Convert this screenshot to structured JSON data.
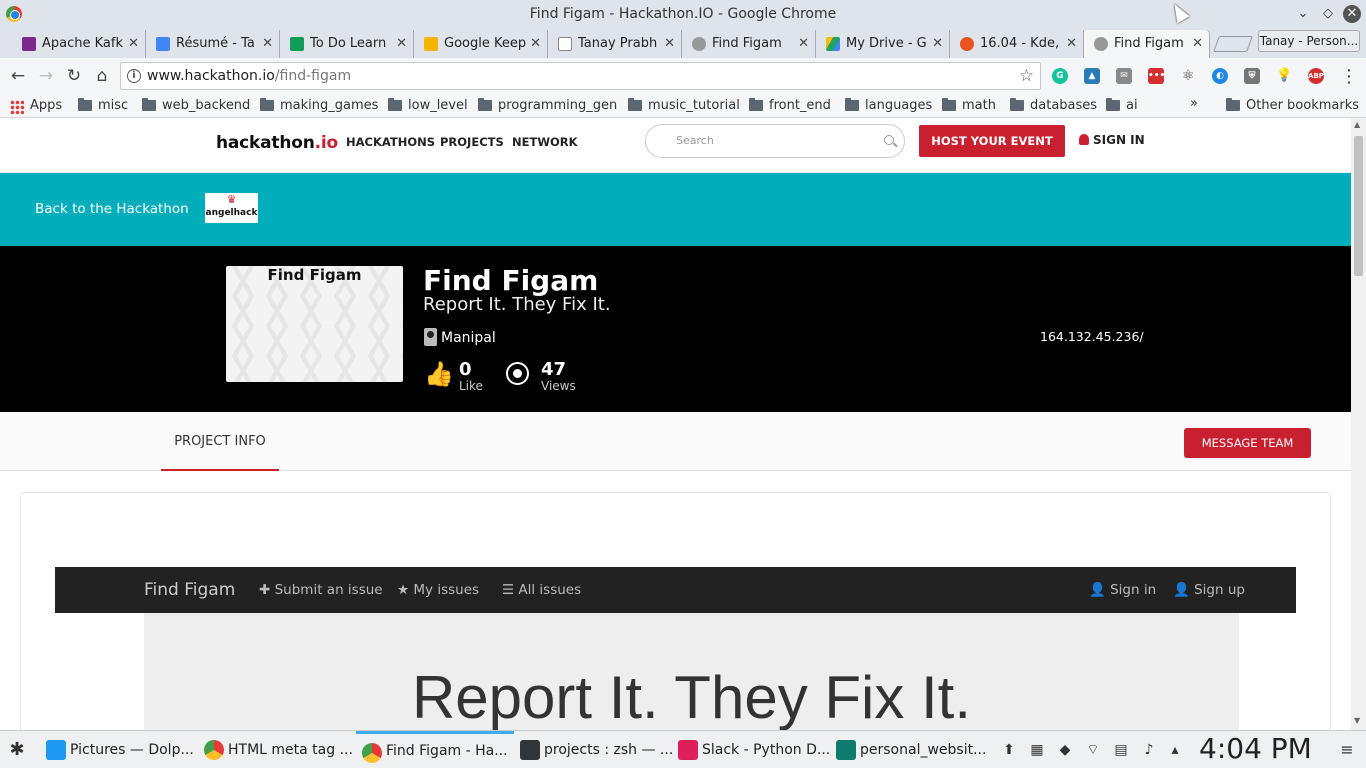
{
  "window": {
    "title": "Find Figam - Hackathon.IO - Google Chrome"
  },
  "tabs": [
    {
      "label": "Apache Kafk",
      "color": "#7b2a8b"
    },
    {
      "label": "Résumé - Ta",
      "color": "#4285f4"
    },
    {
      "label": "To Do Learn",
      "color": "#0f9d58"
    },
    {
      "label": "Google Keep",
      "color": "#f4b400"
    },
    {
      "label": "Tanay Prabh",
      "color": "#888888"
    },
    {
      "label": "Find Figam",
      "color": "#666666"
    },
    {
      "label": "My Drive - G",
      "color": "#1fa463"
    },
    {
      "label": "16.04 - Kde,",
      "color": "#e95420"
    },
    {
      "label": "Find Figam",
      "color": "#666666"
    }
  ],
  "profile": "Tanay - Person...",
  "omnibox": {
    "host": "www.hackathon.io",
    "path": "/find-figam"
  },
  "bookmarks": {
    "apps": "Apps",
    "folders": [
      "misc",
      "web_backend",
      "making_games",
      "low_level",
      "programming_gen",
      "music_tutorial",
      "front_end",
      "languages",
      "math",
      "databases",
      "ai"
    ],
    "more": "»",
    "other": "Other bookmarks"
  },
  "site": {
    "logo_main": "hackathon",
    "logo_io": ".io",
    "nav": [
      "HACKATHONS",
      "PROJECTS",
      "NETWORK"
    ],
    "search_placeholder": "Search",
    "host_button": "HOST YOUR EVENT",
    "sign_in": "SIGN IN"
  },
  "teal": {
    "back_link": "Back to the Hackathon",
    "sponsor_logo": "angelhack"
  },
  "project": {
    "thumb_title": "Find Figam",
    "title": "Find Figam",
    "tagline": "Report It. They Fix It.",
    "location": "Manipal",
    "likes": "0",
    "likes_label": "Like",
    "views": "47",
    "views_label": "Views",
    "link": "164.132.45.236/"
  },
  "tabs_bar": {
    "project_info": "PROJECT INFO",
    "message_team": "MESSAGE TEAM"
  },
  "embed": {
    "brand": "Find Figam",
    "links": [
      "Submit an issue",
      "My issues",
      "All issues"
    ],
    "right_links": [
      "Sign in",
      "Sign up"
    ],
    "hero_text": "Report It. They Fix It."
  },
  "taskbar": {
    "items": [
      {
        "label": "Pictures — Dolp...",
        "color": "#1d99f3"
      },
      {
        "label": "HTML meta tag ...",
        "color": "#db4437"
      },
      {
        "label": "Find Figam - Ha...",
        "color": "#db4437"
      },
      {
        "label": "projects : zsh — ...",
        "color": "#31363b"
      },
      {
        "label": "Slack - Python D...",
        "color": "#e01e5a"
      },
      {
        "label": "personal_websit...",
        "color": "#0f7b6c"
      }
    ],
    "clock": "4:04 PM"
  }
}
